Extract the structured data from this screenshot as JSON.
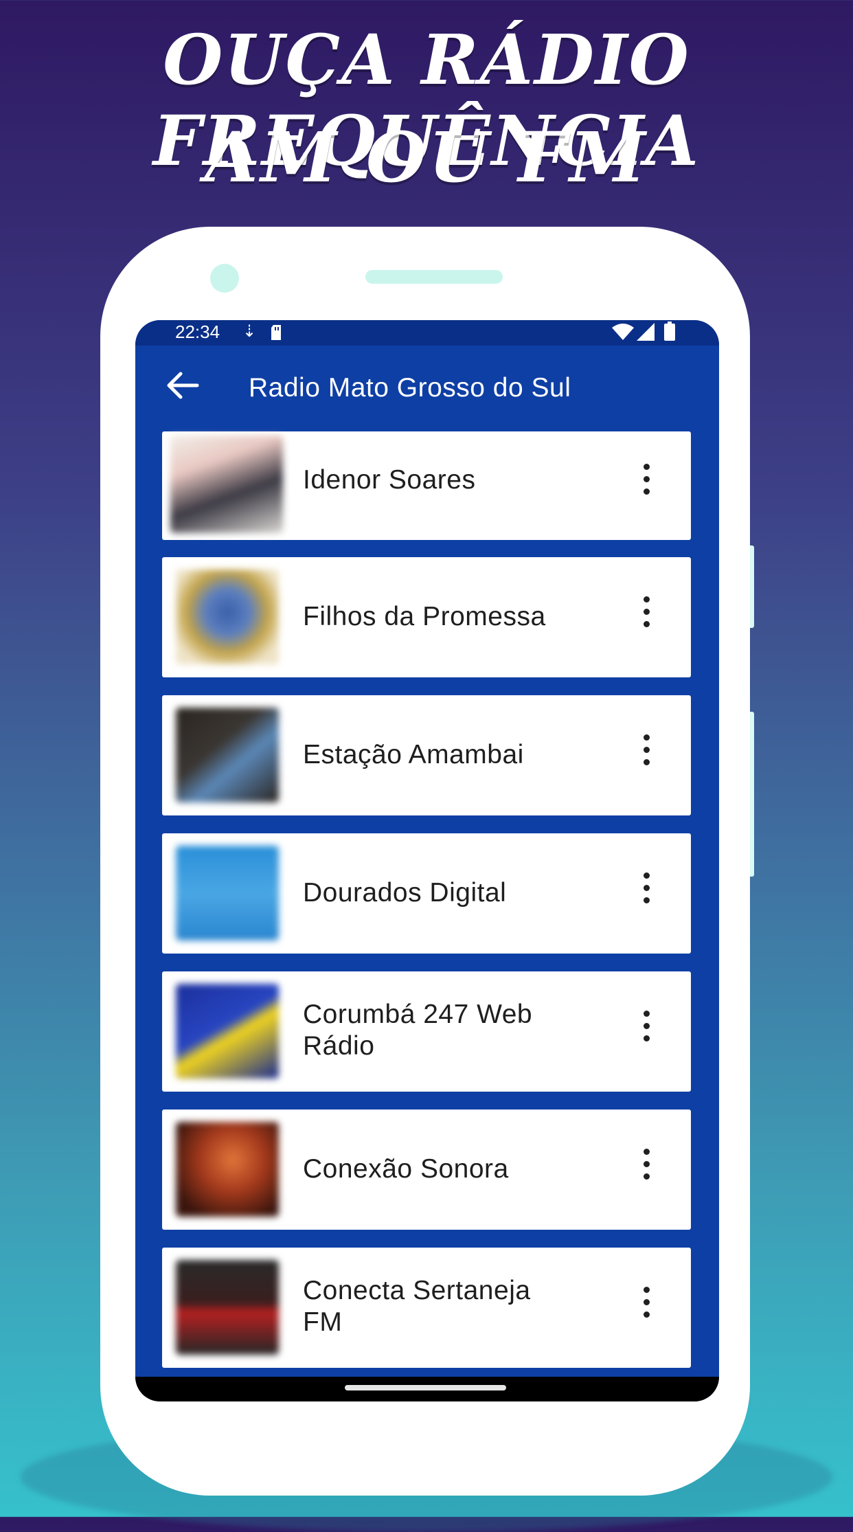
{
  "headline": {
    "line1": "OUÇA RÁDIO FREQUÊNCIA",
    "line2": "AM OU FM"
  },
  "statusbar": {
    "time": "22:34"
  },
  "appbar": {
    "title": "Radio Mato Grosso do Sul",
    "back_icon": "arrow-left-icon"
  },
  "stations": [
    {
      "name": "Idenor Soares"
    },
    {
      "name": "Filhos da Promessa"
    },
    {
      "name": "Estação Amambai"
    },
    {
      "name": "Dourados Digital"
    },
    {
      "name": "Corumbá 247 Web Rádio"
    },
    {
      "name": "Conexão Sonora"
    },
    {
      "name": "Conecta Sertaneja FM"
    }
  ],
  "colors": {
    "appbar": "#0e3fa4",
    "statusbar": "#0a2f88",
    "background_top": "#2f1963",
    "background_bottom": "#36c1cc"
  }
}
